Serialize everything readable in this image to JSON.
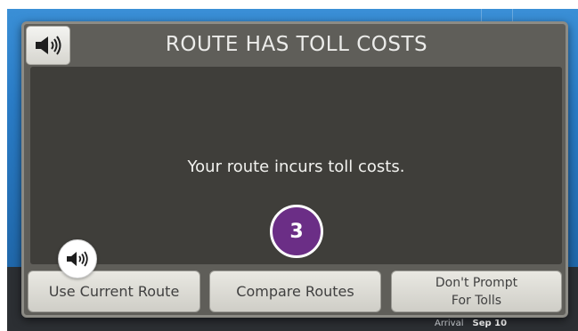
{
  "dialog": {
    "title": "ROUTE HAS TOLL COSTS",
    "message": "Your route incurs toll costs.",
    "speaker_icon": "speaker-icon"
  },
  "annotation": {
    "step_number": "3",
    "color": "#6b2e86",
    "speaker_icon": "speaker-icon"
  },
  "buttons": {
    "use_current": "Use Current Route",
    "compare": "Compare Routes",
    "dont_prompt_line1": "Don't Prompt",
    "dont_prompt_line2": "For Tolls"
  },
  "background": {
    "arrival_label": "Arrival",
    "arrival_value": "Sep 10"
  },
  "colors": {
    "dialog_bg": "#5f5e59",
    "content_bg": "#3f3e3a",
    "button_bg": "#e2e1db",
    "map_blue": "#2a7cc6"
  }
}
